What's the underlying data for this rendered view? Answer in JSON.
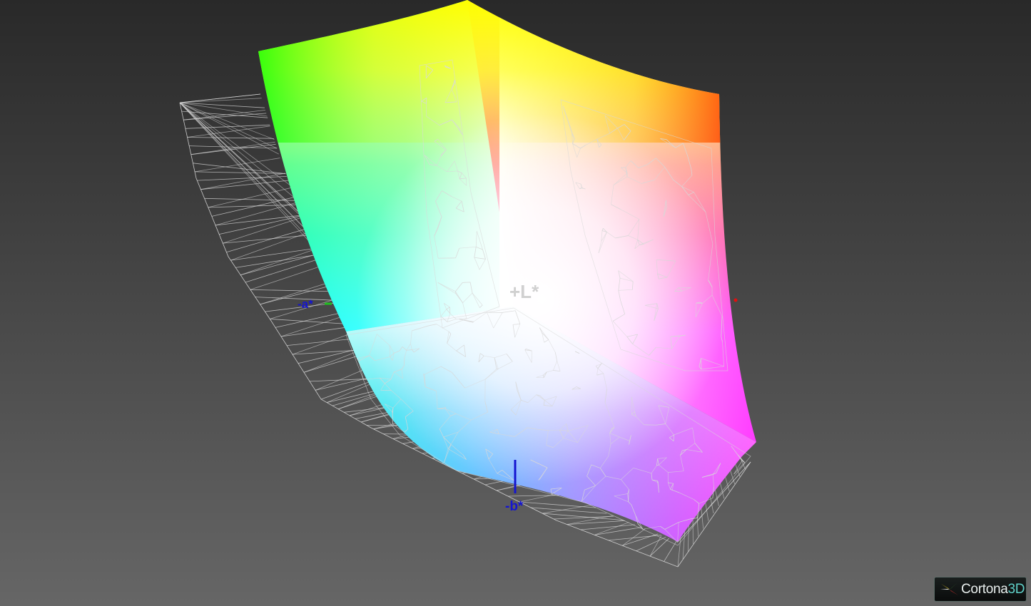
{
  "viewer": {
    "background_top": "#292929",
    "background_bottom": "#666666",
    "wireframe_color": "#d9d9d9"
  },
  "axes": {
    "l_plus": "+L*",
    "a_minus": "-a*",
    "b_minus": "-b*",
    "l_color": "#d0d0d0",
    "a_minus_color": "#1515d0",
    "b_minus_color": "#1515d0",
    "a_plus_marker_color": "#e01010",
    "a_minus_marker_color": "#20c020"
  },
  "gamut": {
    "corner_colors": {
      "green": "#00ff00",
      "yellow": "#ffff00",
      "red": "#ff4000",
      "cyan": "#00ffff",
      "white": "#ffffff",
      "magenta": "#ff30ff",
      "blue": "#4080ff",
      "violet": "#b050ff"
    }
  },
  "logo": {
    "word": "Cortona",
    "suffix": "3D",
    "icon": "cortona-star-icon"
  }
}
